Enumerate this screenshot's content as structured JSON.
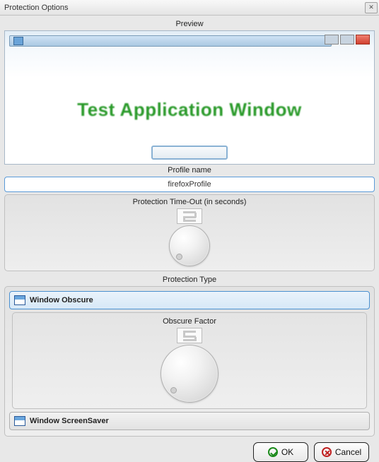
{
  "window": {
    "title": "Protection Options"
  },
  "preview": {
    "label": "Preview",
    "app_title": "Test Application Window"
  },
  "profile": {
    "label": "Profile name",
    "value": "firefoxProfile"
  },
  "timeout": {
    "label": "Protection Time-Out (in seconds)",
    "value": 2
  },
  "protection_type": {
    "label": "Protection Type",
    "options": [
      {
        "label": "Window Obscure",
        "selected": true
      },
      {
        "label": "Window ScreenSaver",
        "selected": false
      }
    ]
  },
  "obscure": {
    "label": "Obscure Factor",
    "value": 5
  },
  "buttons": {
    "ok": "OK",
    "cancel": "Cancel"
  }
}
